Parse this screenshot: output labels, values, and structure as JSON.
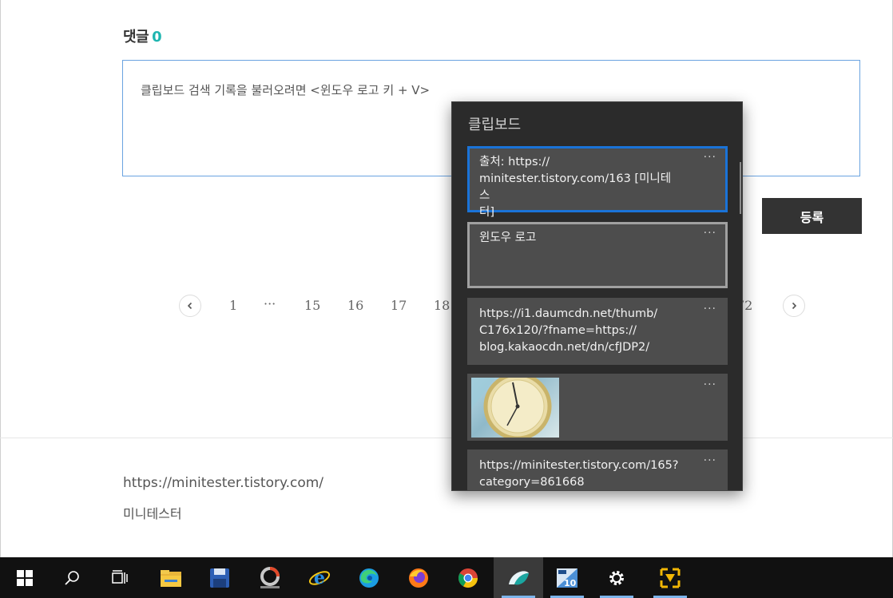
{
  "comments": {
    "title": "댓글",
    "count": "0",
    "placeholder": "클립보드 검색 기록을 불러오려면 <윈도우 로고 키 + V>",
    "submit_label": "등록"
  },
  "pagination": {
    "pages": [
      "1",
      "···",
      "15",
      "16",
      "17",
      "18",
      "72"
    ],
    "prev_icon": "chevron-left-icon",
    "next_icon": "chevron-right-icon"
  },
  "footer": {
    "url": "https://minitester.tistory.com/",
    "name": "미니테스터"
  },
  "clipboard": {
    "title": "클립보드",
    "more_label": "···",
    "items": [
      {
        "text": "출처: https://\nminitester.tistory.com/163 [미니테스\n터]",
        "state": "selected"
      },
      {
        "text": "윈도우 로고",
        "state": "hover"
      },
      {
        "text": "https://i1.daumcdn.net/thumb/\nC176x120/?fname=https://\nblog.kakaocdn.net/dn/cfJDP2/",
        "state": "normal"
      },
      {
        "text": "",
        "state": "image",
        "image": "clock-image"
      },
      {
        "text": "https://minitester.tistory.com/165?\ncategory=861668",
        "state": "normal"
      }
    ]
  },
  "taskbar": {
    "icons": [
      "windows-start-icon",
      "search-icon",
      "task-view-icon",
      "file-explorer-icon",
      "save-disk-icon",
      "photoscape-icon",
      "internet-explorer-icon",
      "edge-icon",
      "firefox-icon",
      "chrome-icon",
      "snipping-app-icon",
      "calculator-app-icon",
      "settings-gear-icon",
      "network-app-icon"
    ],
    "app_badge": "10"
  }
}
